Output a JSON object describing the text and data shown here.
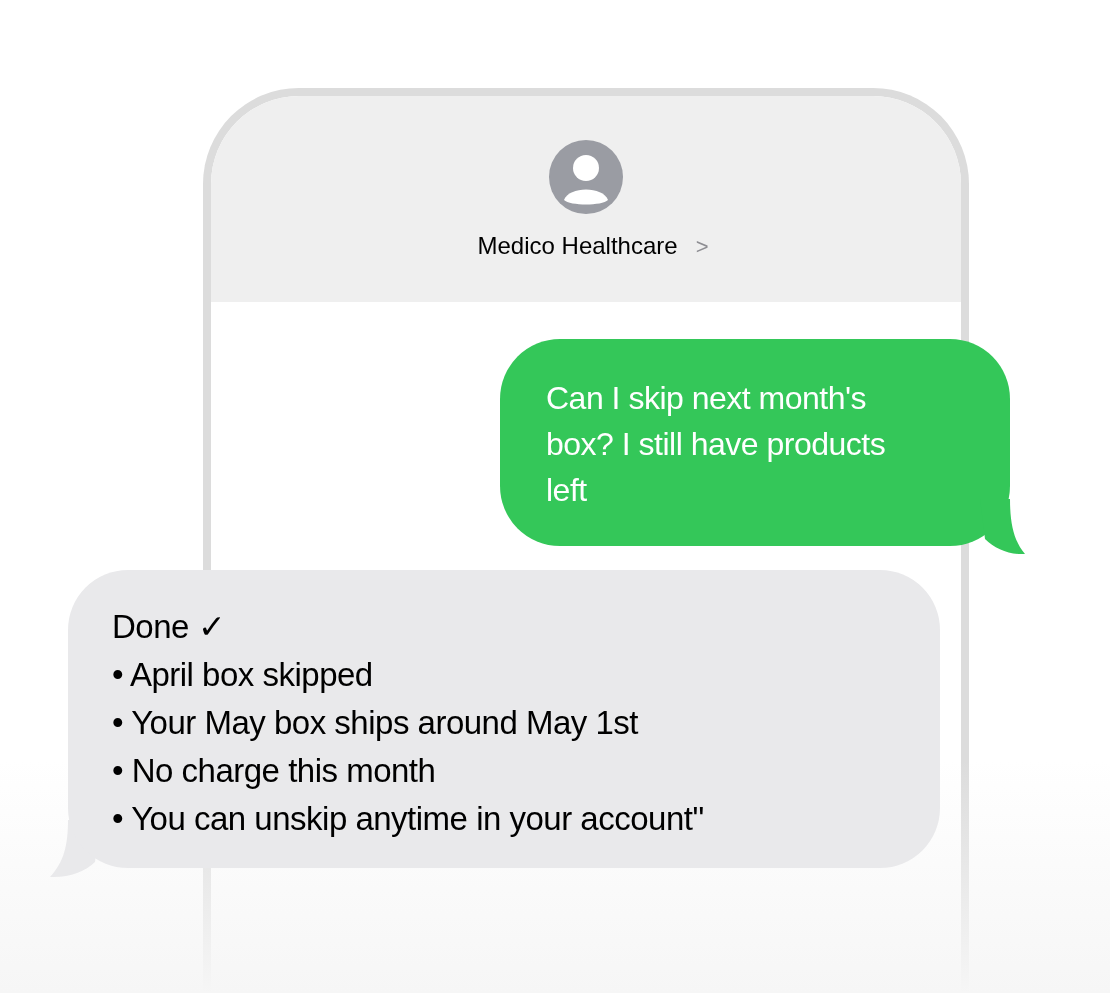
{
  "contact": {
    "name": "Medico Healthcare",
    "chevron": ">"
  },
  "messages": [
    {
      "kind": "sent",
      "lines": [
        "Can I skip next month's",
        "box? I still have products",
        "left"
      ]
    },
    {
      "kind": "received",
      "lines": [
        "Done ✓",
        "• April box skipped",
        "• Your May box ships around May 1st",
        "• No charge this month",
        "• You can unskip anytime in your account\""
      ]
    }
  ]
}
